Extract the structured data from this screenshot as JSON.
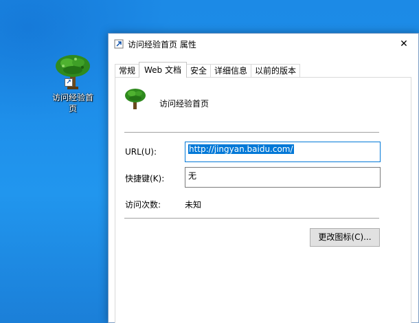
{
  "desktop": {
    "shortcut_label_line1": "访问经验首",
    "shortcut_label_line2": "页",
    "shortcut_arrow": "↗"
  },
  "window": {
    "title": "访问经验首页 属性",
    "close_glyph": "✕"
  },
  "tabs": [
    {
      "label": "常规",
      "active": false
    },
    {
      "label": "Web 文档",
      "active": true
    },
    {
      "label": "安全",
      "active": false
    },
    {
      "label": "详细信息",
      "active": false
    },
    {
      "label": "以前的版本",
      "active": false
    }
  ],
  "panel": {
    "page_name": "访问经验首页",
    "url_label": "URL(U):",
    "url_value": "http://jingyan.baidu.com/",
    "hotkey_label": "快捷键(K):",
    "hotkey_value": "无",
    "visits_label": "访问次数:",
    "visits_value": "未知",
    "change_icon_label": "更改图标(C)..."
  },
  "icons": {
    "tree": "tree-icon",
    "shortcut": "shortcut-arrow-icon",
    "close": "close-icon"
  },
  "colors": {
    "desktop_blue": "#1e8fea",
    "selection_blue": "#0078d7",
    "button_gray": "#e1e1e1",
    "tree_green": "#2f8a1e",
    "trunk_brown": "#6b4a1e"
  }
}
